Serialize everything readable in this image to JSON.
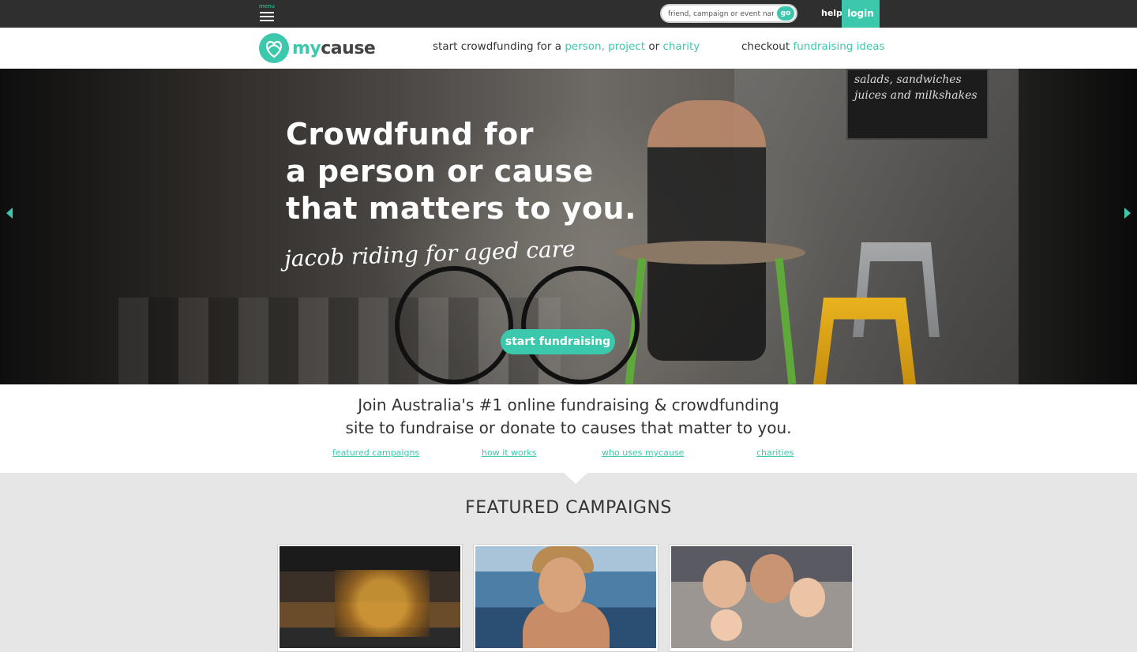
{
  "topbar": {
    "menu_label": "menu",
    "search_placeholder": "friend, campaign or event name",
    "search_go": "go",
    "help": "help",
    "login": "login"
  },
  "header": {
    "logo_text_my": "my",
    "logo_text_cause": "cause",
    "nav_start_prefix": "start crowdfunding for a ",
    "nav_person_project": "person, project",
    "nav_or": " or ",
    "nav_charity": "charity",
    "nav_checkout_prefix": "checkout ",
    "nav_fundraising_ideas": "fundraising ideas"
  },
  "hero": {
    "title_lines": [
      "Crowdfund for",
      "a person or cause",
      "that matters to you."
    ],
    "script": "jacob riding for aged care",
    "cta": "start fundraising",
    "board_line1": "salads, sandwiches",
    "board_line2": "juices and milkshakes"
  },
  "intro": {
    "line1": "Join Australia's #1 online fundraising & crowdfunding",
    "line2": "site to fundraise or donate to causes that matter to you.",
    "links": [
      "featured campaigns",
      "how it works",
      "who uses mycause",
      "charities"
    ]
  },
  "featured": {
    "title": "FEATURED CAMPAIGNS"
  },
  "colors": {
    "accent": "#3cc8ad",
    "topbar": "#2f2f2f",
    "section_bg": "#e6e6e6"
  },
  "icons": {
    "menu": "hamburger-icon",
    "logo": "heart-knot-logo-icon",
    "prev": "triangle-left-icon",
    "next": "triangle-right-icon"
  }
}
